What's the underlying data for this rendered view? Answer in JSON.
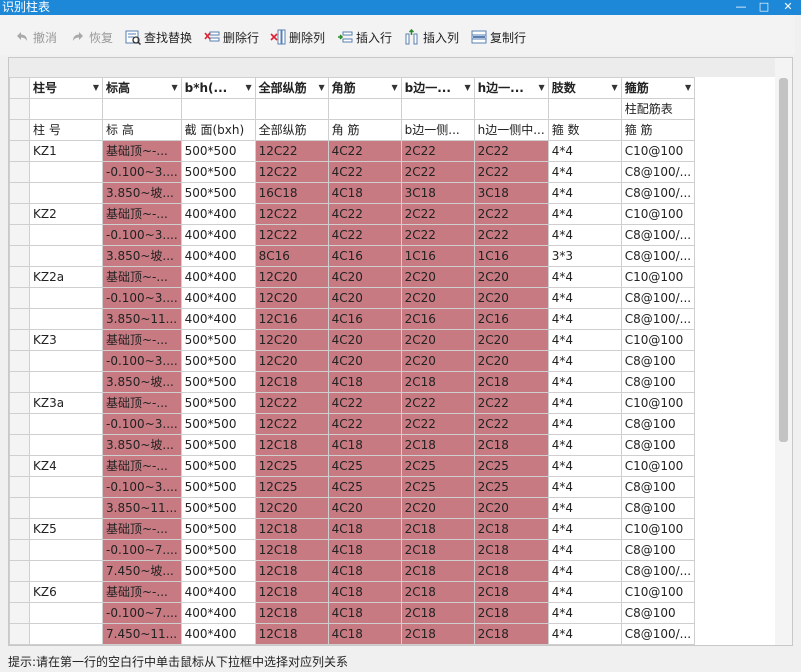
{
  "window": {
    "title": "识别柱表",
    "minimize_glyph": "—",
    "maximize_glyph": "□",
    "close_glyph": "✕"
  },
  "toolbar": {
    "undo": "撤消",
    "redo": "恢复",
    "find_replace": "查找替换",
    "delete_row": "删除行",
    "delete_col": "删除列",
    "insert_row": "插入行",
    "insert_col": "插入列",
    "copy_row": "复制行"
  },
  "grid": {
    "column_headers": [
      "柱号",
      "标高",
      "b*h(...",
      "全部纵筋",
      "角筋",
      "b边一...",
      "h边一...",
      "肢数",
      "箍筋"
    ],
    "row2": [
      "",
      "",
      "",
      "",
      "",
      "",
      "",
      "",
      "柱配筋表"
    ],
    "row3": [
      "柱 号",
      "标 高",
      "截 面(bxh)",
      "全部纵筋",
      "角 筋",
      "b边一侧...",
      "h边一侧中...",
      "箍 数",
      "箍 筋"
    ],
    "rows": [
      [
        "KZ1",
        "基础顶~-...",
        "500*500",
        "12C22",
        "4C22",
        "2C22",
        "2C22",
        "4*4",
        "C10@100"
      ],
      [
        "",
        "-0.100~3....",
        "500*500",
        "12C22",
        "4C22",
        "2C22",
        "2C22",
        "4*4",
        "C8@100/..."
      ],
      [
        "",
        "3.850~坡...",
        "500*500",
        "16C18",
        "4C18",
        "3C18",
        "3C18",
        "4*4",
        "C8@100/..."
      ],
      [
        "KZ2",
        "基础顶~-...",
        "400*400",
        "12C22",
        "4C22",
        "2C22",
        "2C22",
        "4*4",
        "C10@100"
      ],
      [
        "",
        "-0.100~3....",
        "400*400",
        "12C22",
        "4C22",
        "2C22",
        "2C22",
        "4*4",
        "C8@100/..."
      ],
      [
        "",
        "3.850~坡...",
        "400*400",
        "8C16",
        "4C16",
        "1C16",
        "1C16",
        "3*3",
        "C8@100/..."
      ],
      [
        "KZ2a",
        "基础顶~-...",
        "400*400",
        "12C20",
        "4C20",
        "2C20",
        "2C20",
        "4*4",
        "C10@100"
      ],
      [
        "",
        "-0.100~3....",
        "400*400",
        "12C20",
        "4C20",
        "2C20",
        "2C20",
        "4*4",
        "C8@100/..."
      ],
      [
        "",
        "3.850~11...",
        "400*400",
        "12C16",
        "4C16",
        "2C16",
        "2C16",
        "4*4",
        "C8@100/..."
      ],
      [
        "KZ3",
        "基础顶~-...",
        "500*500",
        "12C20",
        "4C20",
        "2C20",
        "2C20",
        "4*4",
        "C10@100"
      ],
      [
        "",
        "-0.100~3....",
        "500*500",
        "12C20",
        "4C20",
        "2C20",
        "2C20",
        "4*4",
        "C8@100"
      ],
      [
        "",
        "3.850~坡...",
        "500*500",
        "12C18",
        "4C18",
        "2C18",
        "2C18",
        "4*4",
        "C8@100"
      ],
      [
        "KZ3a",
        "基础顶~-...",
        "500*500",
        "12C22",
        "4C22",
        "2C22",
        "2C22",
        "4*4",
        "C10@100"
      ],
      [
        "",
        "-0.100~3....",
        "500*500",
        "12C22",
        "4C22",
        "2C22",
        "2C22",
        "4*4",
        "C8@100"
      ],
      [
        "",
        "3.850~坡...",
        "500*500",
        "12C18",
        "4C18",
        "2C18",
        "2C18",
        "4*4",
        "C8@100"
      ],
      [
        "KZ4",
        "基础顶~-...",
        "500*500",
        "12C25",
        "4C25",
        "2C25",
        "2C25",
        "4*4",
        "C10@100"
      ],
      [
        "",
        "-0.100~3....",
        "500*500",
        "12C25",
        "4C25",
        "2C25",
        "2C25",
        "4*4",
        "C8@100"
      ],
      [
        "",
        "3.850~11...",
        "500*500",
        "12C20",
        "4C20",
        "2C20",
        "2C20",
        "4*4",
        "C8@100"
      ],
      [
        "KZ5",
        "基础顶~-...",
        "500*500",
        "12C18",
        "4C18",
        "2C18",
        "2C18",
        "4*4",
        "C10@100"
      ],
      [
        "",
        "-0.100~7....",
        "500*500",
        "12C18",
        "4C18",
        "2C18",
        "2C18",
        "4*4",
        "C8@100"
      ],
      [
        "",
        "7.450~坡...",
        "500*500",
        "12C18",
        "4C18",
        "2C18",
        "2C18",
        "4*4",
        "C8@100/..."
      ],
      [
        "KZ6",
        "基础顶~-...",
        "400*400",
        "12C18",
        "4C18",
        "2C18",
        "2C18",
        "4*4",
        "C10@100"
      ],
      [
        "",
        "-0.100~7....",
        "400*400",
        "12C18",
        "4C18",
        "2C18",
        "2C18",
        "4*4",
        "C8@100"
      ],
      [
        "",
        "7.450~11...",
        "400*400",
        "12C18",
        "4C18",
        "2C18",
        "2C18",
        "4*4",
        "C8@100/..."
      ]
    ],
    "pink_columns": [
      1,
      3,
      4,
      5,
      6
    ],
    "highlight_color": "#c87a82"
  },
  "status": {
    "hint": "提示:请在第一行的空白行中单击鼠标从下拉框中选择对应列关系"
  },
  "colors": {
    "titlebar": "#1e88d8",
    "grid_border": "#cfcfcf"
  }
}
